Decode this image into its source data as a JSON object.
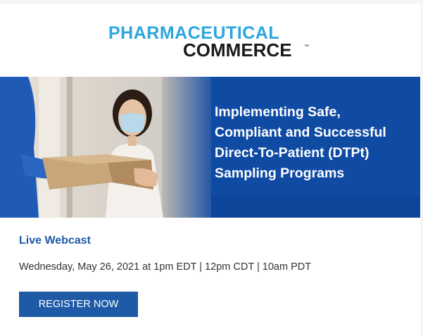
{
  "logo": {
    "line1": "PHARMACEUTICAL",
    "line2": "COMMERCE",
    "tm": "™"
  },
  "banner": {
    "title_lines": [
      "Implementing Safe,",
      "Compliant and Successful",
      "Direct-To-Patient (DTPt)",
      "Sampling Programs"
    ]
  },
  "event": {
    "label": "Live Webcast",
    "date_line": "Wednesday, May 26, 2021 at 1pm EDT | 12pm CDT | 10am PDT"
  },
  "cta": {
    "register_label": "REGISTER NOW"
  },
  "colors": {
    "brand_blue": "#2ba6de",
    "banner_blue": "#0f4aa3",
    "button_blue": "#1f5aa7",
    "label_blue": "#1d5aa6"
  }
}
